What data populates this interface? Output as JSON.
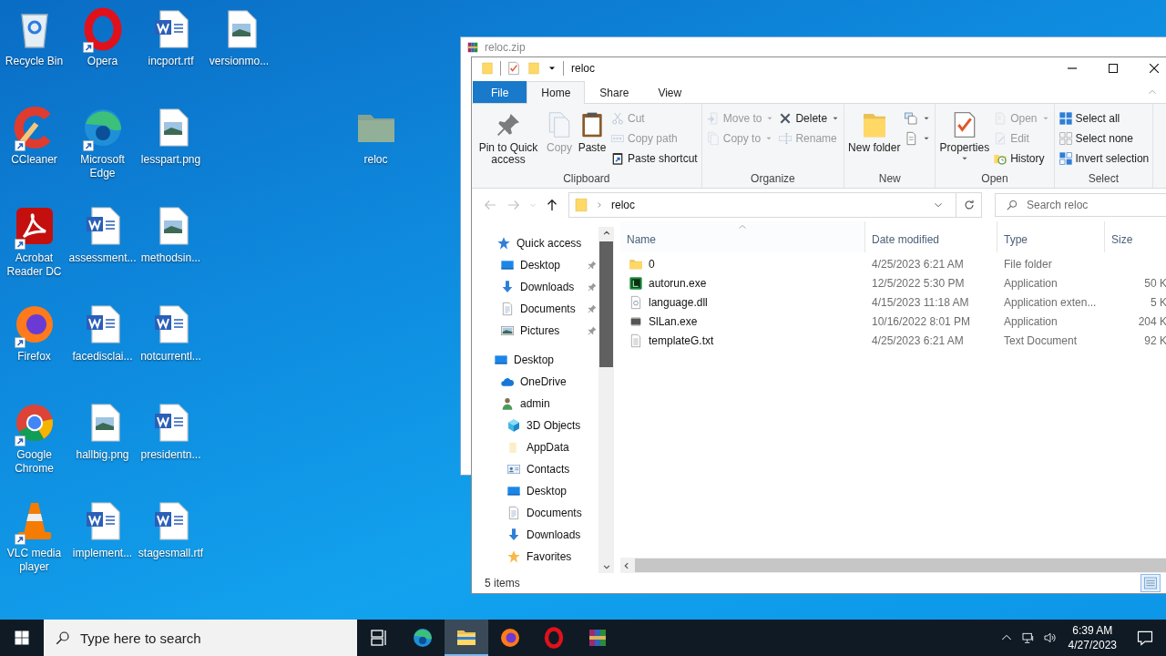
{
  "desktop": {
    "icons": [
      {
        "label": "Recycle Bin",
        "kind": "recycle",
        "shortcut": false
      },
      {
        "label": "CCleaner",
        "kind": "ccleaner",
        "shortcut": true
      },
      {
        "label": "Acrobat Reader DC",
        "kind": "acrobat",
        "shortcut": true
      },
      {
        "label": "Firefox",
        "kind": "firefox",
        "shortcut": true
      },
      {
        "label": "Google Chrome",
        "kind": "chrome",
        "shortcut": true
      },
      {
        "label": "VLC media player",
        "kind": "vlc",
        "shortcut": true
      },
      {
        "label": "Opera",
        "kind": "opera",
        "shortcut": true
      },
      {
        "label": "Microsoft Edge",
        "kind": "edge",
        "shortcut": true
      },
      {
        "label": "assessment...",
        "kind": "word",
        "shortcut": false
      },
      {
        "label": "facedisclai...",
        "kind": "word",
        "shortcut": false
      },
      {
        "label": "hallbig.png",
        "kind": "image",
        "shortcut": false
      },
      {
        "label": "implement...",
        "kind": "word",
        "shortcut": false
      },
      {
        "label": "incport.rtf",
        "kind": "word",
        "shortcut": false
      },
      {
        "label": "lesspart.png",
        "kind": "image",
        "shortcut": false
      },
      {
        "label": "methodsin...",
        "kind": "image",
        "shortcut": false
      },
      {
        "label": "notcurrentl...",
        "kind": "word",
        "shortcut": false
      },
      {
        "label": "presidentn...",
        "kind": "word",
        "shortcut": false
      },
      {
        "label": "stagesmall.rtf",
        "kind": "word",
        "shortcut": false
      },
      {
        "label": "versionmo...",
        "kind": "image",
        "shortcut": false
      }
    ],
    "separate_icon": {
      "label": "reloc",
      "kind": "folder",
      "shortcut": false,
      "dimmed": true
    }
  },
  "background_window": {
    "title": "reloc.zip"
  },
  "explorer": {
    "title": "reloc",
    "ribbon_tabs": [
      {
        "label": "File",
        "kind": "file",
        "selected": false
      },
      {
        "label": "Home",
        "kind": "tab",
        "selected": true
      },
      {
        "label": "Share",
        "kind": "tab",
        "selected": false
      },
      {
        "label": "View",
        "kind": "tab",
        "selected": false
      }
    ],
    "ribbon_groups": [
      {
        "label": "Clipboard",
        "columns": [
          {
            "kind": "large",
            "buttons": [
              {
                "kind": "pin",
                "label": "Pin to Quick access",
                "disabled": false,
                "dropdown": false
              }
            ]
          },
          {
            "kind": "large",
            "buttons": [
              {
                "kind": "copy",
                "label": "Copy",
                "disabled": true,
                "dropdown": false
              }
            ]
          },
          {
            "kind": "large",
            "buttons": [
              {
                "kind": "paste",
                "label": "Paste",
                "disabled": false,
                "dropdown": false
              }
            ]
          },
          {
            "kind": "stack",
            "buttons": [
              {
                "kind": "cut",
                "label": "Cut",
                "disabled": true,
                "dropdown": false
              },
              {
                "kind": "copypath",
                "label": "Copy path",
                "disabled": true,
                "dropdown": false
              },
              {
                "kind": "pasteshortcut",
                "label": "Paste shortcut",
                "disabled": false,
                "dropdown": false
              }
            ]
          }
        ]
      },
      {
        "label": "Organize",
        "columns": [
          {
            "kind": "stack",
            "buttons": [
              {
                "kind": "moveto",
                "label": "Move to",
                "disabled": true,
                "dropdown": true
              },
              {
                "kind": "copyto",
                "label": "Copy to",
                "disabled": true,
                "dropdown": true
              }
            ]
          },
          {
            "kind": "stack",
            "buttons": [
              {
                "kind": "delete",
                "label": "Delete",
                "disabled": false,
                "dropdown": true
              },
              {
                "kind": "rename",
                "label": "Rename",
                "disabled": true,
                "dropdown": false
              }
            ]
          }
        ]
      },
      {
        "label": "New",
        "columns": [
          {
            "kind": "large",
            "buttons": [
              {
                "kind": "newfolder",
                "label": "New folder",
                "disabled": false,
                "dropdown": false
              }
            ]
          },
          {
            "kind": "stack",
            "buttons": [
              {
                "kind": "newitem",
                "disabled": false,
                "dropdown": true
              },
              {
                "kind": "easyaccess",
                "disabled": false,
                "dropdown": true
              }
            ]
          }
        ]
      },
      {
        "label": "Open",
        "columns": [
          {
            "kind": "large",
            "buttons": [
              {
                "kind": "properties",
                "label": "Properties",
                "disabled": false,
                "dropdown": true
              }
            ]
          },
          {
            "kind": "stack",
            "buttons": [
              {
                "kind": "open",
                "label": "Open",
                "disabled": true,
                "dropdown": true
              },
              {
                "kind": "edit",
                "label": "Edit",
                "disabled": true,
                "dropdown": false
              },
              {
                "kind": "history",
                "label": "History",
                "disabled": false,
                "dropdown": false
              }
            ]
          }
        ]
      },
      {
        "label": "Select",
        "columns": [
          {
            "kind": "stack",
            "buttons": [
              {
                "kind": "selectall",
                "label": "Select all",
                "disabled": false,
                "dropdown": false
              },
              {
                "kind": "selectnone",
                "label": "Select none",
                "disabled": false,
                "dropdown": false
              },
              {
                "kind": "invert",
                "label": "Invert selection",
                "disabled": false,
                "dropdown": false
              }
            ]
          }
        ]
      }
    ],
    "nav_buttons": [
      {
        "kind": "back",
        "disabled": true
      },
      {
        "kind": "forward",
        "disabled": true
      },
      {
        "kind": "recent",
        "disabled": true
      },
      {
        "kind": "up",
        "disabled": false
      }
    ],
    "address": {
      "segments": [
        "reloc"
      ]
    },
    "search": {
      "placeholder": "Search reloc"
    },
    "nav_pane": [
      {
        "label": "Quick access",
        "kind": "quick",
        "children": [
          {
            "label": "Desktop",
            "kind": "desktop",
            "pinned": true
          },
          {
            "label": "Downloads",
            "kind": "downloads",
            "pinned": true
          },
          {
            "label": "Documents",
            "kind": "documents",
            "pinned": true
          },
          {
            "label": "Pictures",
            "kind": "pictures",
            "pinned": true
          }
        ]
      },
      {
        "label": "Desktop",
        "kind": "desktop",
        "children": [
          {
            "label": "OneDrive",
            "kind": "onedrive"
          },
          {
            "label": "admin",
            "kind": "user",
            "children": [
              {
                "label": "3D Objects",
                "kind": "cube"
              },
              {
                "label": "AppData",
                "kind": "paleFolder"
              },
              {
                "label": "Contacts",
                "kind": "contacts"
              },
              {
                "label": "Desktop",
                "kind": "desktop"
              },
              {
                "label": "Documents",
                "kind": "documents"
              },
              {
                "label": "Downloads",
                "kind": "downloads"
              },
              {
                "label": "Favorites",
                "kind": "star"
              }
            ]
          }
        ]
      }
    ],
    "columns": [
      {
        "label": "Name",
        "sorted": true
      },
      {
        "label": "Date modified",
        "sorted": false
      },
      {
        "label": "Type",
        "sorted": false
      },
      {
        "label": "Size",
        "sorted": false
      }
    ],
    "files": [
      {
        "kind": "folder",
        "name": "0",
        "date": "4/25/2023 6:21 AM",
        "type": "File folder"
      },
      {
        "kind": "greenapp",
        "name": "autorun.exe",
        "date": "12/5/2022 5:30 PM",
        "type": "Application",
        "size": "50 K"
      },
      {
        "kind": "dll",
        "name": "language.dll",
        "date": "4/15/2023 11:18 AM",
        "type": "Application exten...",
        "size": "5 K"
      },
      {
        "kind": "chip",
        "name": "SlLan.exe",
        "date": "10/16/2022 8:01 PM",
        "type": "Application",
        "size": "204 K"
      },
      {
        "kind": "txt",
        "name": "templateG.txt",
        "date": "4/25/2023 6:21 AM",
        "type": "Text Document",
        "size": "92 K"
      }
    ],
    "status": "5 items"
  },
  "taskbar": {
    "search_placeholder": "Type here to search",
    "apps": [
      {
        "kind": "taskview",
        "active": false
      },
      {
        "kind": "edge",
        "active": false
      },
      {
        "kind": "explorer",
        "active": true
      },
      {
        "kind": "firefox",
        "active": false
      },
      {
        "kind": "opera",
        "active": false
      },
      {
        "kind": "winrar",
        "active": false
      }
    ],
    "time": "6:39 AM",
    "date": "4/27/2023"
  }
}
